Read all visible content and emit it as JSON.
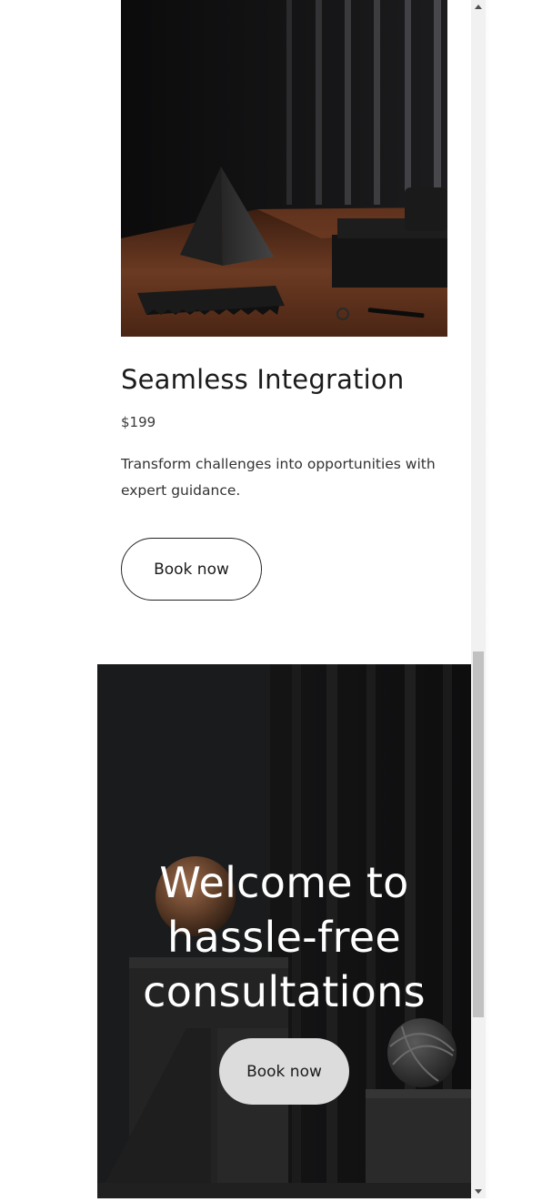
{
  "product": {
    "title": "Seamless Integration",
    "price": "$199",
    "description": "Transform challenges into opportunities with expert guidance.",
    "button_label": "Book now",
    "image_subject": "dark still life with pyramid sculpture on wooden table"
  },
  "hero": {
    "title_lines": [
      "Welcome to",
      "hassle-free",
      "consultations"
    ],
    "button_label": "Book now",
    "image_subject": "dark still life with spheres and blocks"
  },
  "scrollbar": {
    "up_icon": "triangle-up-icon",
    "down_icon": "triangle-down-icon"
  },
  "colors": {
    "page_bg": "#ffffff",
    "hero_bg": "#181919",
    "text_dark": "#1b1b1b",
    "hero_text": "#ffffff",
    "hero_button_bg": "#dcdcdc",
    "scroll_thumb": "#c1c1c1"
  }
}
